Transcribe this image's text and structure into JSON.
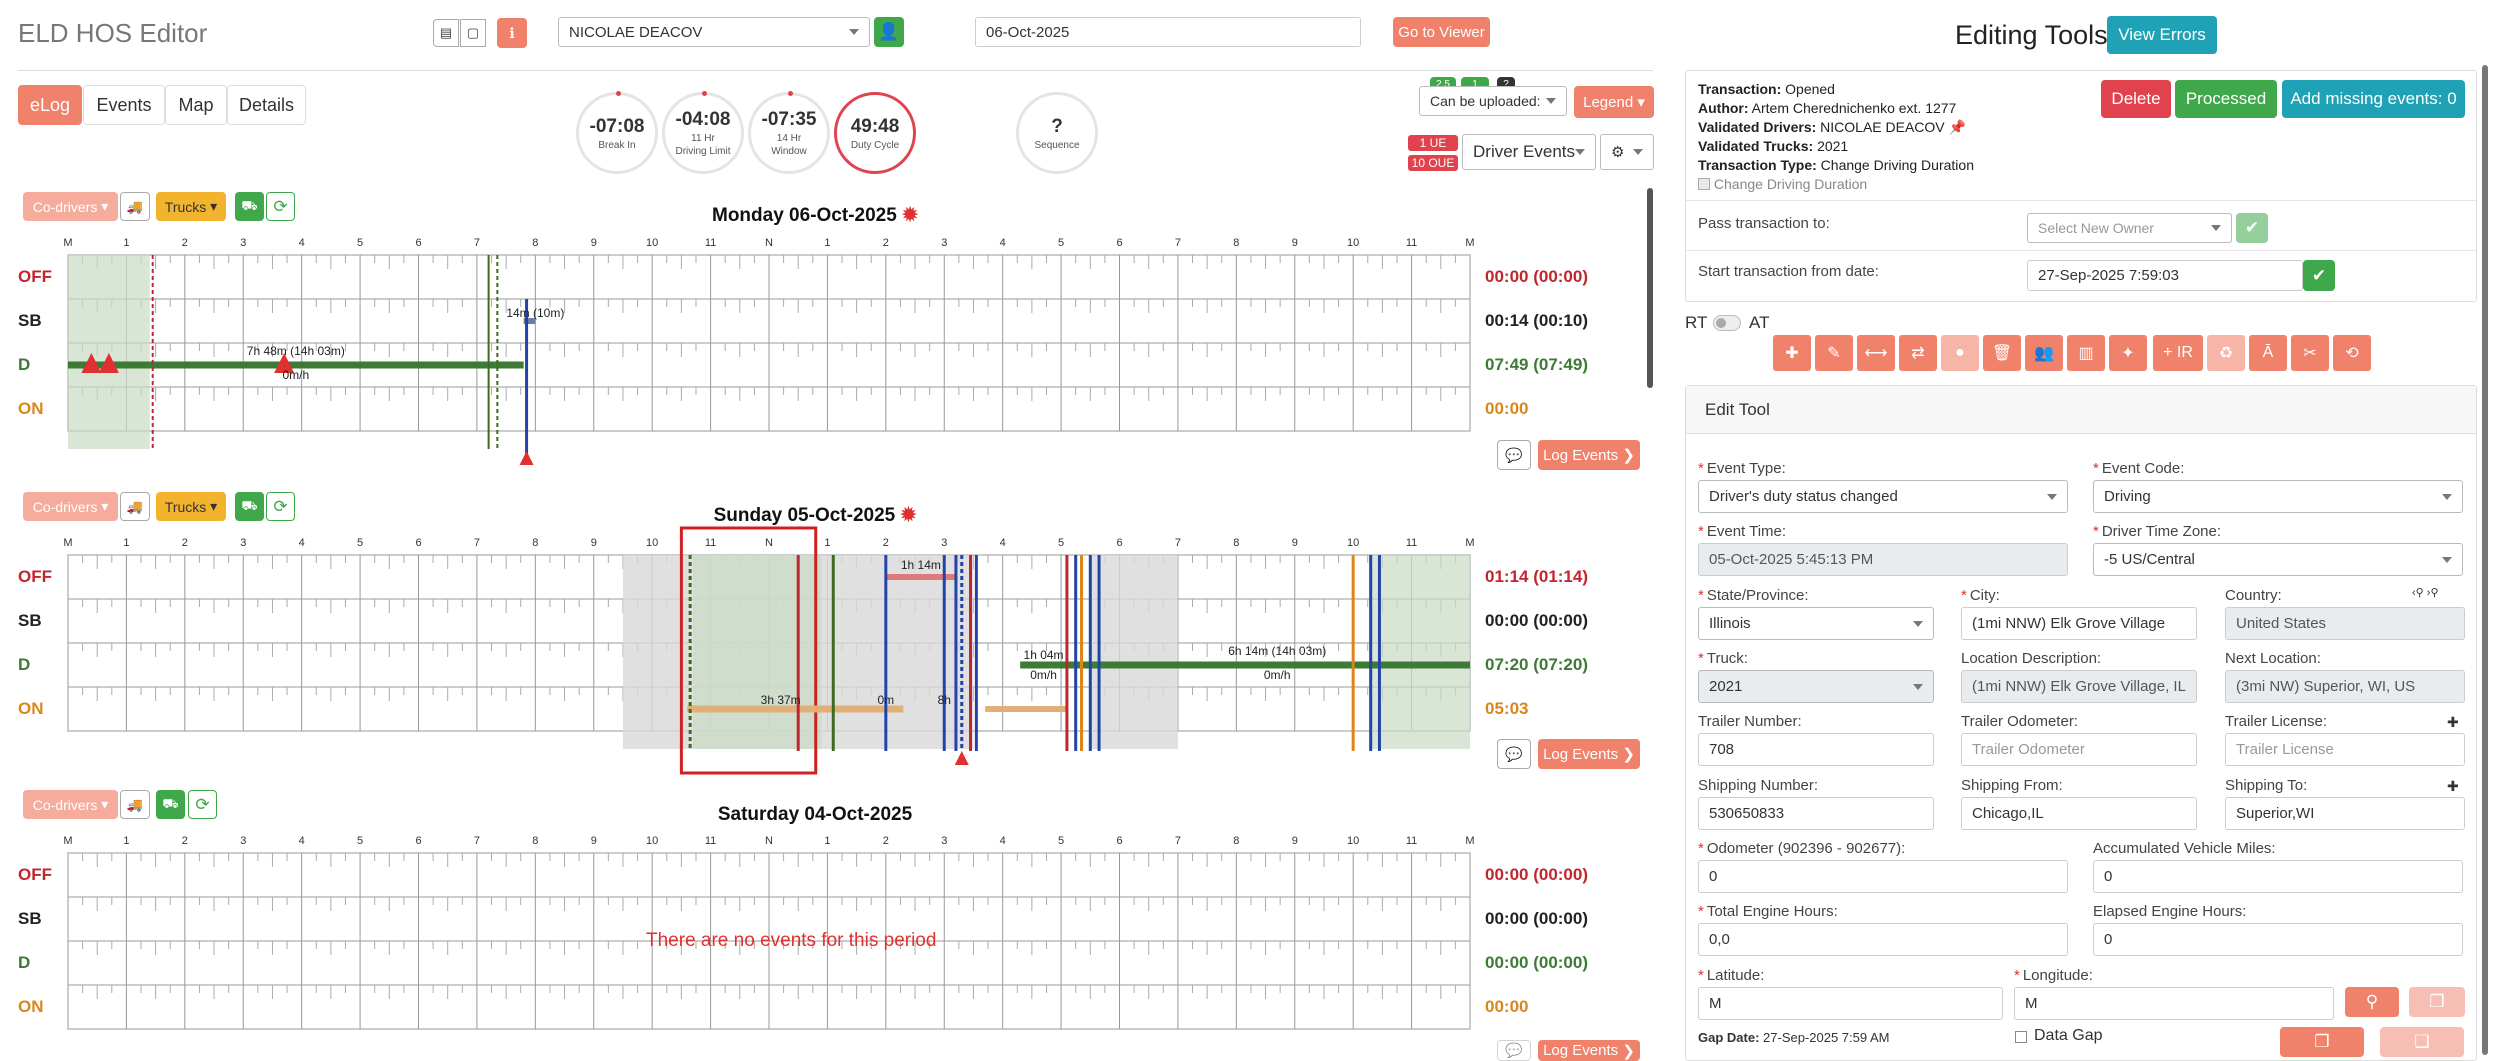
{
  "header": {
    "app_title": "ELD HOS Editor",
    "driver": "NICOLAE DEACOV",
    "date": "06-Oct-2025",
    "go_viewer": "Go to Viewer"
  },
  "tabs": [
    {
      "label": "eLog"
    },
    {
      "label": "Events"
    },
    {
      "label": "Map"
    },
    {
      "label": "Details"
    }
  ],
  "gauges": [
    {
      "value": "-07:08",
      "sub1": "Break In",
      "sub2": ""
    },
    {
      "value": "-04:08",
      "sub1": "11 Hr",
      "sub2": "Driving Limit"
    },
    {
      "value": "-07:35",
      "sub1": "14 Hr",
      "sub2": "Window"
    },
    {
      "value": "49:48",
      "sub1": "Duty Cycle",
      "sub2": ""
    },
    {
      "value": "?",
      "sub1": "Sequence",
      "sub2": ""
    }
  ],
  "upload": {
    "badge1": "2.5",
    "badge2": "1",
    "badge3": "?",
    "select": "Can be uploaded:",
    "legend": "Legend"
  },
  "oue": {
    "ue": "1 UE",
    "oue": "10 OUE",
    "driver_events": "Driver Events"
  },
  "toolbar": {
    "codrivers": "Co-drivers",
    "trucks": "Trucks"
  },
  "axis": {
    "hours": [
      "M",
      "1",
      "2",
      "3",
      "4",
      "5",
      "6",
      "7",
      "8",
      "9",
      "10",
      "11",
      "N",
      "1",
      "2",
      "3",
      "4",
      "5",
      "6",
      "7",
      "8",
      "9",
      "10",
      "11",
      "M"
    ]
  },
  "rows": [
    "OFF",
    "SB",
    "D",
    "ON"
  ],
  "days": [
    {
      "title": "Monday 06-Oct-2025",
      "totals": [
        "00:00 (00:00)",
        "00:14 (00:10)",
        "07:49 (07:49)",
        "00:00"
      ],
      "annotations": [
        {
          "text": "7h 48m (14h 03m)"
        },
        {
          "text": "0m/h"
        },
        {
          "text": "14m (10m)"
        }
      ],
      "log_events": "Log Events"
    },
    {
      "title": "Sunday 05-Oct-2025",
      "totals": [
        "01:14 (01:14)",
        "00:00 (00:00)",
        "07:20 (07:20)",
        "05:03"
      ],
      "annotations": [
        {
          "text": "1h 14m"
        },
        {
          "text": "3h 37m"
        },
        {
          "text": "0m"
        },
        {
          "text": "1h 04m"
        },
        {
          "text": "0m/h"
        },
        {
          "text": "6h 14m (14h 03m)"
        },
        {
          "text": "0m/h"
        },
        {
          "text": "8h"
        }
      ],
      "log_events": "Log Events"
    },
    {
      "title": "Saturday 04-Oct-2025",
      "totals": [
        "00:00 (00:00)",
        "00:00 (00:00)",
        "00:00 (00:00)",
        "00:00"
      ],
      "no_events": "There are no events for this period",
      "log_events": "Log Events"
    }
  ],
  "right": {
    "title": "Editing Tools",
    "view_errors": "View Errors",
    "transaction": {
      "l1": "Transaction:",
      "v1": "Opened",
      "l2": "Author:",
      "v2": "Artem Cherednichenko ext. 1277",
      "l3": "Validated Drivers:",
      "v3": "NICOLAE DEACOV",
      "l4": "Validated Trucks:",
      "v4": "2021",
      "l5": "Transaction Type:",
      "v5": "Change Driving Duration",
      "check": "Change Driving Duration"
    },
    "delete": "Delete",
    "processed": "Processed",
    "add_missing": "Add missing events: 0",
    "pass_label": "Pass transaction to:",
    "pass_placeholder": "Select New Owner",
    "start_label": "Start transaction from date:",
    "start_value": "27-Sep-2025 7:59:03",
    "rt": "RT",
    "at": "AT",
    "plus_ir": "+ IR",
    "edit_tool": "Edit Tool",
    "fields": {
      "event_type_l": "Event Type:",
      "event_type": "Driver's duty status changed",
      "event_code_l": "Event Code:",
      "event_code": "Driving",
      "event_time_l": "Event Time:",
      "event_time": "05-Oct-2025 5:45:13 PM",
      "tz_l": "Driver Time Zone:",
      "tz": "-5 US/Central",
      "state_l": "State/Province:",
      "state": "Illinois",
      "city_l": "City:",
      "city": "(1mi NNW) Elk Grove Village",
      "country_l": "Country:",
      "country": "United States",
      "truck_l": "Truck:",
      "truck": "2021",
      "locdesc_l": "Location Description:",
      "locdesc": "(1mi NNW) Elk Grove Village, IL, US",
      "nextloc_l": "Next Location:",
      "nextloc": "(3mi NW) Superior, WI, US",
      "trailer_l": "Trailer Number:",
      "trailer": "708",
      "trailer_odo_l": "Trailer Odometer:",
      "trailer_odo_ph": "Trailer Odometer",
      "trailer_lic_l": "Trailer License:",
      "trailer_lic_ph": "Trailer License",
      "ship_no_l": "Shipping Number:",
      "ship_no": "530650833",
      "ship_from_l": "Shipping From:",
      "ship_from": "Chicago,IL",
      "ship_to_l": "Shipping To:",
      "ship_to": "Superior,WI",
      "odo_l": "Odometer (902396 - 902677):",
      "odo": "0",
      "acc_miles_l": "Accumulated Vehicle Miles:",
      "acc_miles": "0",
      "eng_hours_l": "Total Engine Hours:",
      "eng_hours": "0,0",
      "elapsed_l": "Elapsed Engine Hours:",
      "elapsed": "0",
      "lat_l": "Latitude:",
      "lat": "M",
      "lon_l": "Longitude:",
      "lon": "M",
      "gap_l": "Gap Date:",
      "gap": "27-Sep-2025 7:59 AM",
      "data_gap": "Data Gap"
    }
  },
  "colors": {
    "off": "#c0262d",
    "sb": "#222222",
    "d": "#3d7a35",
    "on": "#d9861b",
    "salmon": "#f0816a"
  }
}
